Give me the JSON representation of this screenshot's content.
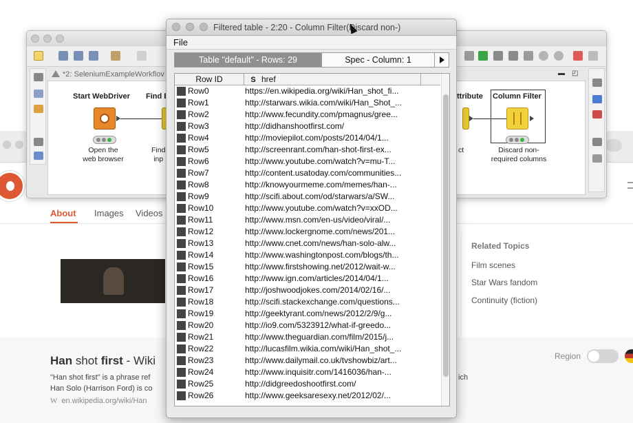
{
  "browser": {
    "nav": [
      "About",
      "Images",
      "Videos"
    ],
    "related_title": "Related Topics",
    "related_items": [
      "Film scenes",
      "Star Wars fandom",
      "Continuity (fiction)"
    ],
    "result_title_bold": "Han",
    "result_title_rest": " shot ",
    "result_title_bold2": "first",
    "result_title_tail": " - Wiki",
    "snippet_line1": "\"Han shot first\" is a phrase ref",
    "snippet_line2": "Han Solo (Harrison Ford) is co",
    "snippet_right": "ich",
    "result_url": "en.wikipedia.org/wiki/Han",
    "region_label": "Region",
    "colors": {
      "accent": "#de5833"
    }
  },
  "knime": {
    "editor_tab": "*2: SeleniumExampleWorkflov",
    "nodes": [
      {
        "name": "Start WebDriver",
        "desc1": "Open the",
        "desc2": "web browser",
        "color": "#e8862c"
      },
      {
        "name": "Find E",
        "desc1": "Find",
        "desc2": "inp",
        "color": "#e8c62c"
      },
      {
        "name": "ttribute",
        "desc1": "ct",
        "desc2": "",
        "color": "#e8c62c"
      },
      {
        "name": "Column Filter",
        "desc1": "Discard non-",
        "desc2": "required columns",
        "color": "#f2d23a"
      }
    ]
  },
  "filtered_table": {
    "title": "Filtered table - 2:20 - Column Filter(Discard non-)",
    "menu_file": "File",
    "tab_active": "Table \"default\" - Rows: 29",
    "tab_spec": "Spec - Column: 1",
    "col_rowid": "Row ID",
    "col_href_type": "S",
    "col_href": "href",
    "rows": [
      {
        "id": "Row0",
        "href": "https://en.wikipedia.org/wiki/Han_shot_fi..."
      },
      {
        "id": "Row1",
        "href": "http://starwars.wikia.com/wiki/Han_Shot_..."
      },
      {
        "id": "Row2",
        "href": "http://www.fecundity.com/pmagnus/gree..."
      },
      {
        "id": "Row3",
        "href": "http://didhanshootfirst.com/"
      },
      {
        "id": "Row4",
        "href": "http://moviepilot.com/posts/2014/04/1..."
      },
      {
        "id": "Row5",
        "href": "http://screenrant.com/han-shot-first-ex..."
      },
      {
        "id": "Row6",
        "href": "http://www.youtube.com/watch?v=mu-T..."
      },
      {
        "id": "Row7",
        "href": "http://content.usatoday.com/communities..."
      },
      {
        "id": "Row8",
        "href": "http://knowyourmeme.com/memes/han-..."
      },
      {
        "id": "Row9",
        "href": "http://scifi.about.com/od/starwars/a/SW..."
      },
      {
        "id": "Row10",
        "href": "http://www.youtube.com/watch?v=xxOD..."
      },
      {
        "id": "Row11",
        "href": "http://www.msn.com/en-us/video/viral/..."
      },
      {
        "id": "Row12",
        "href": "http://www.lockergnome.com/news/201..."
      },
      {
        "id": "Row13",
        "href": "http://www.cnet.com/news/han-solo-alw..."
      },
      {
        "id": "Row14",
        "href": "http://www.washingtonpost.com/blogs/th..."
      },
      {
        "id": "Row15",
        "href": "http://www.firstshowing.net/2012/wait-w..."
      },
      {
        "id": "Row16",
        "href": "http://www.ign.com/articles/2014/04/1..."
      },
      {
        "id": "Row17",
        "href": "http://joshwoodjokes.com/2014/02/16/..."
      },
      {
        "id": "Row18",
        "href": "http://scifi.stackexchange.com/questions..."
      },
      {
        "id": "Row19",
        "href": "http://geektyrant.com/news/2012/2/9/g..."
      },
      {
        "id": "Row20",
        "href": "http://io9.com/5323912/what-if-greedo..."
      },
      {
        "id": "Row21",
        "href": "http://www.theguardian.com/film/2015/j..."
      },
      {
        "id": "Row22",
        "href": "http://lucasfilm.wikia.com/wiki/Han_shot_..."
      },
      {
        "id": "Row23",
        "href": "http://www.dailymail.co.uk/tvshowbiz/art..."
      },
      {
        "id": "Row24",
        "href": "http://www.inquisitr.com/1416036/han-..."
      },
      {
        "id": "Row25",
        "href": "http://didgreedoshootfirst.com/"
      },
      {
        "id": "Row26",
        "href": "http://www.geeksaresexy.net/2012/02/..."
      }
    ]
  }
}
